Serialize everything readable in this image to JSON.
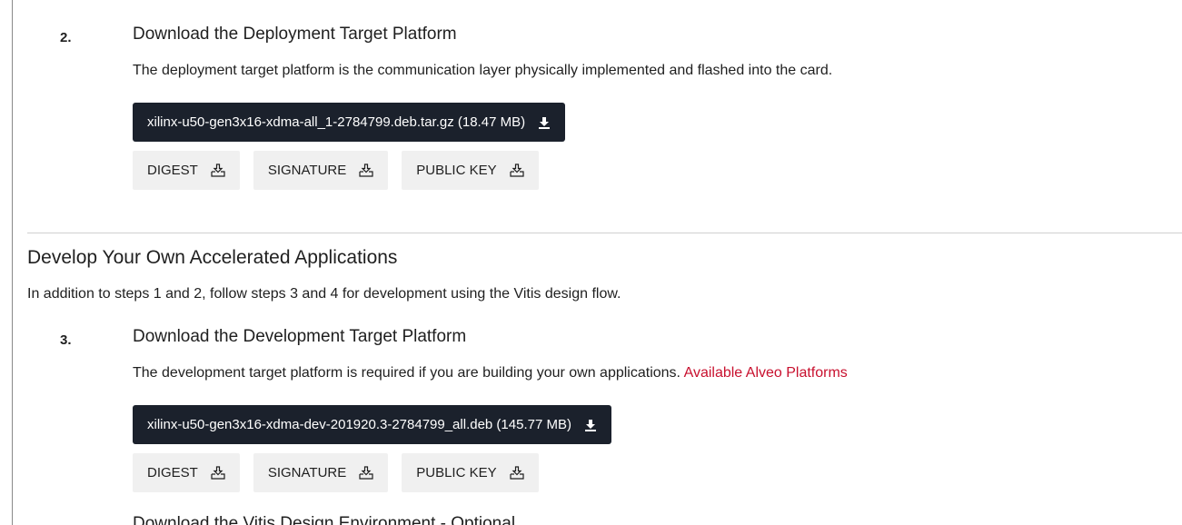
{
  "step2": {
    "number": "2.",
    "title": "Download the Deployment Target Platform",
    "description": "The deployment target platform is the communication layer physically implemented and flashed into the card.",
    "download_label": "xilinx-u50-gen3x16-xdma-all_1-2784799.deb.tar.gz (18.47 MB)",
    "digest_label": "DIGEST",
    "signature_label": "SIGNATURE",
    "public_key_label": "PUBLIC KEY"
  },
  "section": {
    "title": "Develop Your Own Accelerated Applications",
    "description": "In addition to steps 1 and 2, follow steps 3 and 4 for development using the Vitis design flow."
  },
  "step3": {
    "number": "3.",
    "title": "Download the Development Target Platform",
    "description": "The development target platform is required if you are building your own applications.",
    "link_label": "Available Alveo Platforms",
    "download_label": "xilinx-u50-gen3x16-xdma-dev-201920.3-2784799_all.deb (145.77 MB)",
    "digest_label": "DIGEST",
    "signature_label": "SIGNATURE",
    "public_key_label": "PUBLIC KEY"
  },
  "step4": {
    "title_partial": "Download the Vitis Design Environment - Optional"
  },
  "colors": {
    "link": "#c8102e",
    "download_button_bg": "#1b212c",
    "aux_button_bg": "#f0f0f0"
  }
}
